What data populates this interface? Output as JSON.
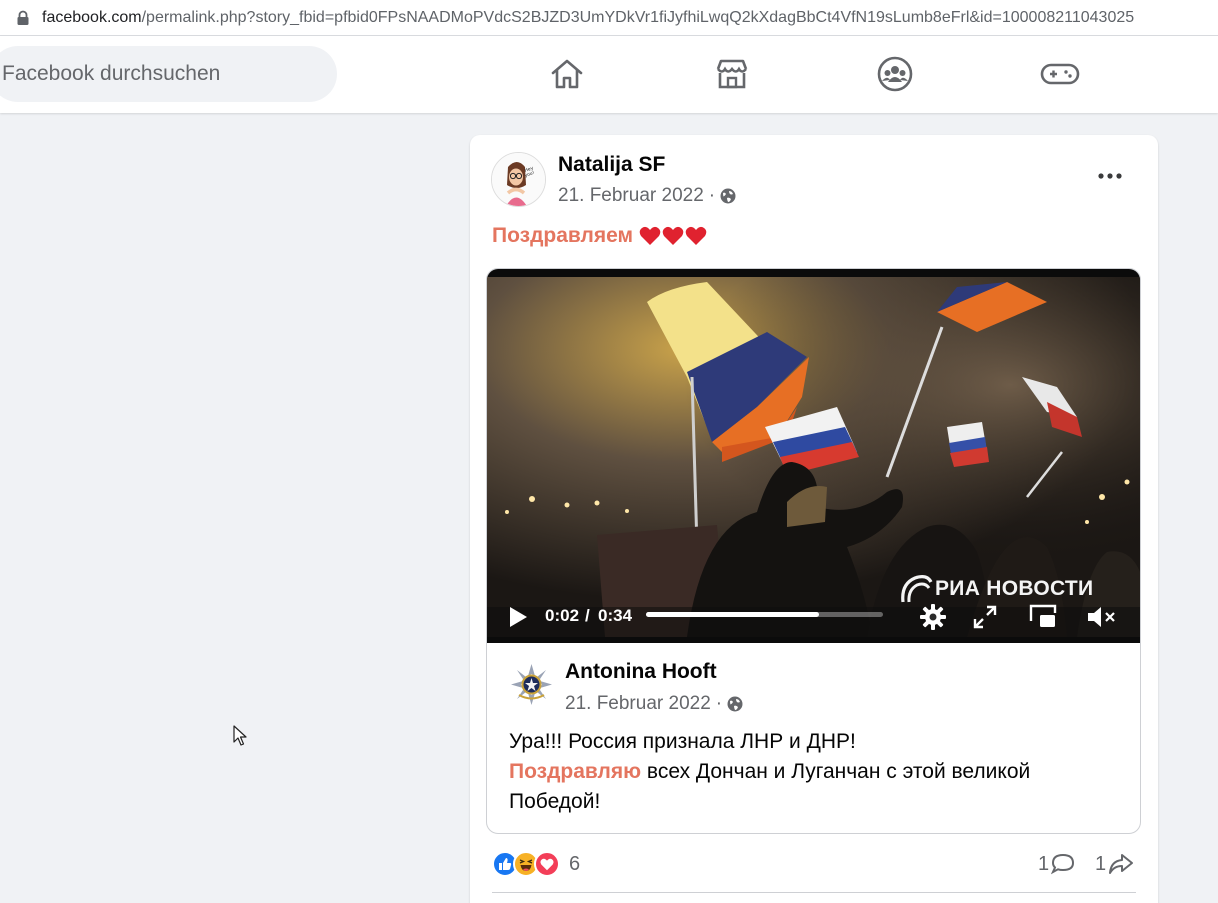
{
  "browser": {
    "url_host": "facebook.com",
    "url_rest": "/permalink.php?story_fbid=pfbid0FPsNAADMoPVdcS2BJZD3UmYDkVr1fiJyfhiLwqQ2kXdagBbCt4VfN19sLumb8eFrl&id=100008211043025"
  },
  "topbar": {
    "search_placeholder": "Facebook durchsuchen",
    "nav_icons": [
      "home-icon",
      "marketplace-icon",
      "groups-icon",
      "gaming-icon"
    ]
  },
  "post": {
    "author": "Natalija SF",
    "date": "21. Februar 2022",
    "separator": "·",
    "privacy_icon": "globe-icon",
    "text": "Поздравляем",
    "emoji_count": 3,
    "emoji": "red-heart",
    "highlight_color": "#e4755f",
    "video": {
      "current_time": "0:02",
      "separator": "/",
      "duration": "0:34",
      "progress": 0.73,
      "watermark": "РИА НОВОСТИ",
      "controls": [
        "settings-icon",
        "fullscreen-icon",
        "picture-in-picture-icon",
        "muted-icon"
      ]
    },
    "shared": {
      "author": "Antonina Hooft",
      "date": "21. Februar 2022",
      "separator": "·",
      "line1": "Ура!!! Россия признала ЛНР и ДНР!",
      "highlight": "Поздравляю",
      "line2_rest": " всех Дончан и Луганчан с  этой великой Победой!"
    },
    "reactions": {
      "icons": [
        "like-icon",
        "haha-icon",
        "love-icon"
      ],
      "count": "6",
      "comments": "1",
      "shares": "1"
    }
  }
}
